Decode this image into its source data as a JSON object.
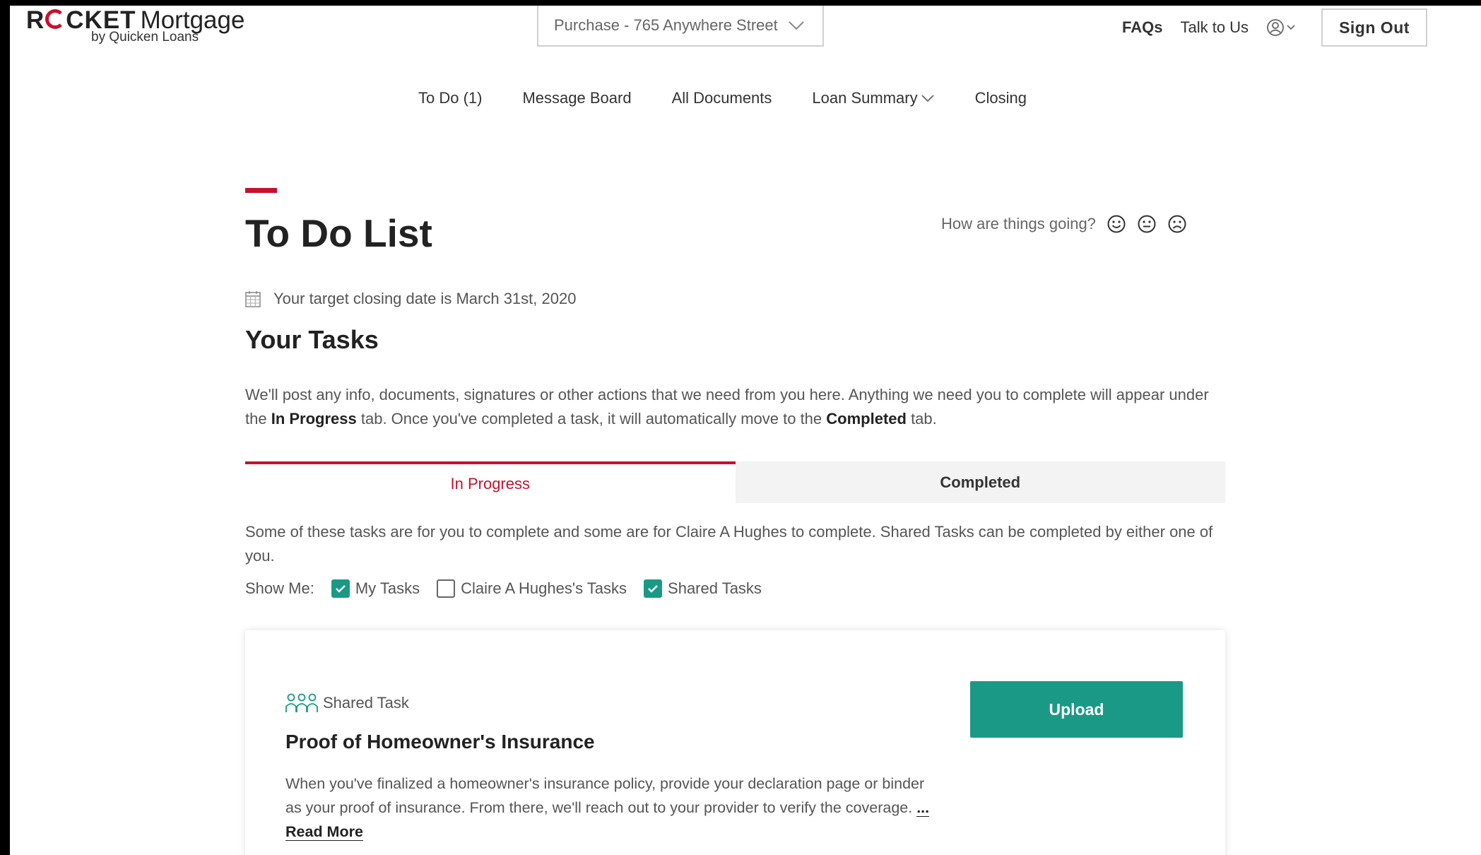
{
  "colors": {
    "brand_red": "#c8102e",
    "accent_teal": "#1a9a86",
    "tab_inactive_bg": "#f3f3f3"
  },
  "header": {
    "logo": {
      "brand_prefix": "R",
      "brand_suffix": "CKET",
      "product": "Mortgage",
      "tagline": "by Quicken Loans"
    },
    "loan_selector": {
      "value": "Purchase - 765 Anywhere Street",
      "icon": "chevron-down-icon"
    },
    "faqs": "FAQs",
    "talk": "Talk to Us",
    "account_icon": "user-circle-icon",
    "sign_out": "Sign Out"
  },
  "nav": {
    "items": [
      {
        "label": "To Do (1)"
      },
      {
        "label": "Message Board"
      },
      {
        "label": "All Documents"
      },
      {
        "label": "Loan Summary",
        "dropdown": true
      },
      {
        "label": "Closing"
      }
    ]
  },
  "main": {
    "title": "To Do List",
    "feedback": {
      "prompt": "How are things going?",
      "faces": [
        "happy-face-icon",
        "neutral-face-icon",
        "sad-face-icon"
      ]
    },
    "target_date": "Your target closing date is March 31st, 2020",
    "section_title": "Your Tasks",
    "description": {
      "part1": "We'll post any info, documents, signatures or other actions that we need from you here. Anything we need you to complete will appear under the ",
      "bold1": "In Progress",
      "part2": " tab. Once you've completed a task, it will automatically move to the ",
      "bold2": "Completed",
      "part3": " tab."
    },
    "tabs": [
      {
        "label": "In Progress",
        "active": true
      },
      {
        "label": "Completed",
        "active": false
      }
    ],
    "info": "Some of these tasks are for you to complete and some are for Claire A Hughes to complete. Shared Tasks can be completed by either one of you.",
    "filters": {
      "label": "Show Me:",
      "options": [
        {
          "label": "My Tasks",
          "checked": true
        },
        {
          "label": "Claire A Hughes's Tasks",
          "checked": false
        },
        {
          "label": "Shared Tasks",
          "checked": true
        }
      ]
    },
    "task": {
      "type": "Shared Task",
      "title": "Proof of Homeowner's Insurance",
      "description": "When you've finalized a homeowner's insurance policy, provide your declaration page or binder as your proof of insurance. From there, we'll reach out to your provider to verify the coverage. ",
      "read_more": "... Read More",
      "action": "Upload"
    }
  }
}
